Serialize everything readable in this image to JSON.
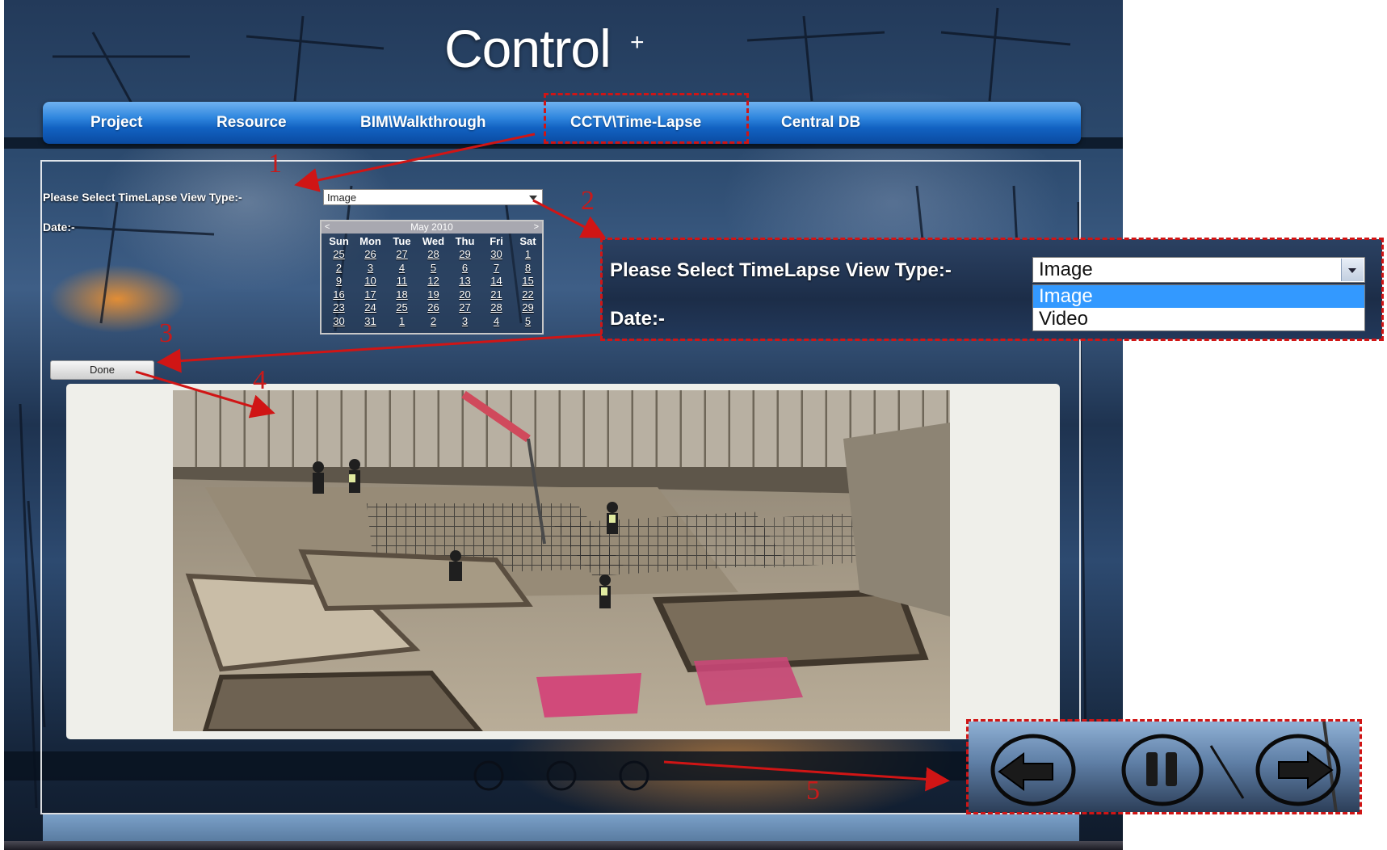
{
  "app": {
    "title": "Control",
    "title_superscript": "+"
  },
  "nav": {
    "items": [
      {
        "label": "Project"
      },
      {
        "label": "Resource"
      },
      {
        "label": "BIM\\Walkthrough"
      },
      {
        "label": "CCTV\\Time-Lapse"
      },
      {
        "label": "Central DB"
      }
    ]
  },
  "form": {
    "view_type_label": "Please Select TimeLapse View Type:-",
    "view_type_value": "Image",
    "date_label": "Date:-",
    "done_label": "Done"
  },
  "calendar": {
    "prev": "<",
    "next": ">",
    "month_label": "May 2010",
    "weekdays": [
      "Sun",
      "Mon",
      "Tue",
      "Wed",
      "Thu",
      "Fri",
      "Sat"
    ],
    "days": [
      "25",
      "26",
      "27",
      "28",
      "29",
      "30",
      "1",
      "2",
      "3",
      "4",
      "5",
      "6",
      "7",
      "8",
      "9",
      "10",
      "11",
      "12",
      "13",
      "14",
      "15",
      "16",
      "17",
      "18",
      "19",
      "20",
      "21",
      "22",
      "23",
      "24",
      "25",
      "26",
      "27",
      "28",
      "29",
      "30",
      "31",
      "1",
      "2",
      "3",
      "4",
      "5"
    ]
  },
  "zoom_view_type": {
    "label": "Please Select TimeLapse View Type:-",
    "date_label": "Date:-",
    "selected": "Image",
    "options": [
      "Image",
      "Video"
    ]
  },
  "annotations": {
    "numbers": [
      "1",
      "2",
      "3",
      "4",
      "5"
    ]
  },
  "playback": {
    "icons": [
      "back-arrow-icon",
      "pause-icon",
      "forward-arrow-icon"
    ]
  },
  "colors": {
    "callout": "#d01515",
    "nav_blue": "#1a6cd0",
    "select_highlight": "#3399ff"
  }
}
